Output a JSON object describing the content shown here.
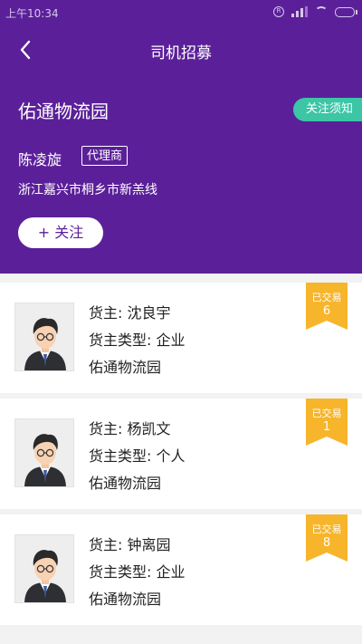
{
  "status_bar": {
    "time": "上午10:34"
  },
  "nav": {
    "title": "司机招募"
  },
  "profile": {
    "company": "佑通物流园",
    "notice_button": "关注须知",
    "person": "陈凌旋",
    "role_badge": "代理商",
    "address": "浙江嘉兴市桐乡市新羔线",
    "follow_button": "+ 关注"
  },
  "cards": [
    {
      "owner_line": "货主: 沈良宇",
      "type_line": "货主类型: 企业",
      "company": "佑通物流园",
      "badge_label": "已交易",
      "count": "6"
    },
    {
      "owner_line": "货主: 杨凯文",
      "type_line": "货主类型: 个人",
      "company": "佑通物流园",
      "badge_label": "已交易",
      "count": "1"
    },
    {
      "owner_line": "货主: 钟离园",
      "type_line": "货主类型: 企业",
      "company": "佑通物流园",
      "badge_label": "已交易",
      "count": "8"
    }
  ],
  "colors": {
    "header": "#5b2099",
    "accent": "#3cc6a6",
    "ribbon": "#f7b52c"
  },
  "icons": {
    "back": "chevron-left-icon",
    "avatar": "person-avatar-icon",
    "ribbon": "traded-ribbon-icon"
  }
}
